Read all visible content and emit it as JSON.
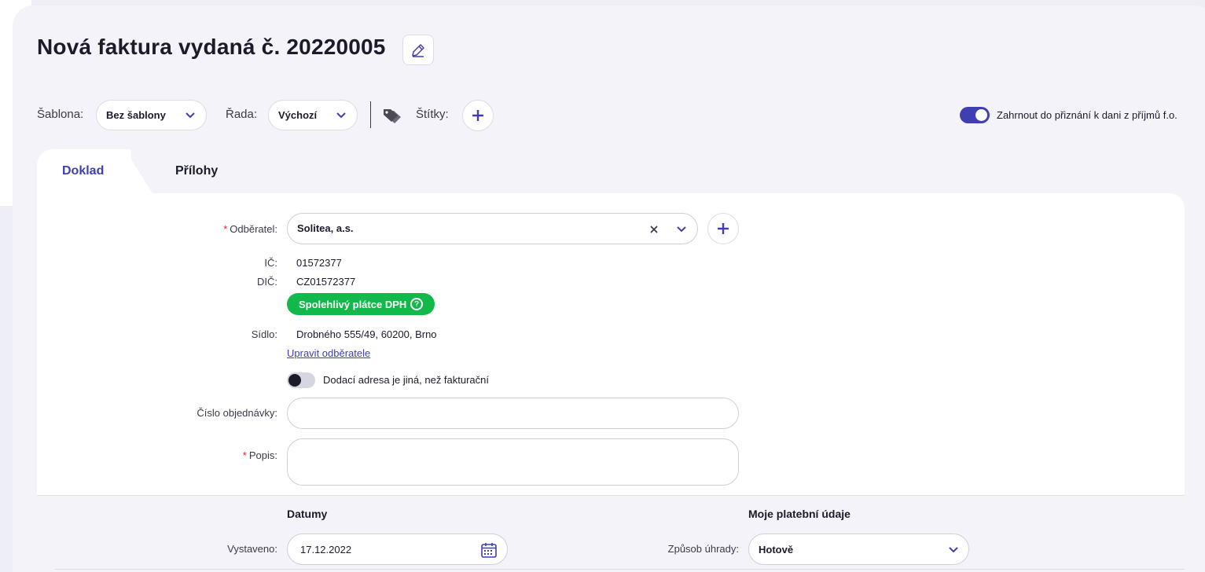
{
  "header": {
    "title": "Nová faktura vydaná č. 20220005",
    "edit_icon": "pencil-icon"
  },
  "toolbar": {
    "template_label": "Šablona:",
    "template_value": "Bez šablony",
    "series_label": "Řada:",
    "series_value": "Výchozí",
    "tags_icon": "tags-icon",
    "tags_label": "Štítky:",
    "add_tag_icon": "plus-icon",
    "tax_toggle_label": "Zahrnout do přiznání k dani z příjmů f.o.",
    "tax_toggle_on": true
  },
  "tabs": [
    {
      "label": "Doklad",
      "active": true
    },
    {
      "label": "Přílohy",
      "active": false
    }
  ],
  "form": {
    "customer_label": "Odběratel:",
    "customer_value": "Solitea, a.s.",
    "ic_label": "IČ:",
    "ic_value": "01572377",
    "dic_label": "DIČ:",
    "dic_value": "CZ01572377",
    "vat_badge": "Spolehlivý plátce DPH",
    "vat_badge_q": "?",
    "seat_label": "Sídlo:",
    "seat_value": "Drobného 555/49, 60200, Brno",
    "edit_customer_link": "Upravit odběratele",
    "delivery_toggle_label": "Dodací adresa je jiná, než fakturační",
    "delivery_toggle_on": false,
    "order_label": "Číslo objednávky:",
    "order_value": "",
    "desc_label": "Popis:",
    "desc_value": ""
  },
  "dates": {
    "section_title": "Datumy",
    "issued_label": "Vystaveno:",
    "issued_value": "17.12.2022"
  },
  "payment": {
    "section_title": "Moje platební údaje",
    "method_label": "Způsob úhrady:",
    "method_value": "Hotově"
  },
  "colors": {
    "accent": "#3f3fb2",
    "success": "#13b84a",
    "required": "#e0203a"
  }
}
